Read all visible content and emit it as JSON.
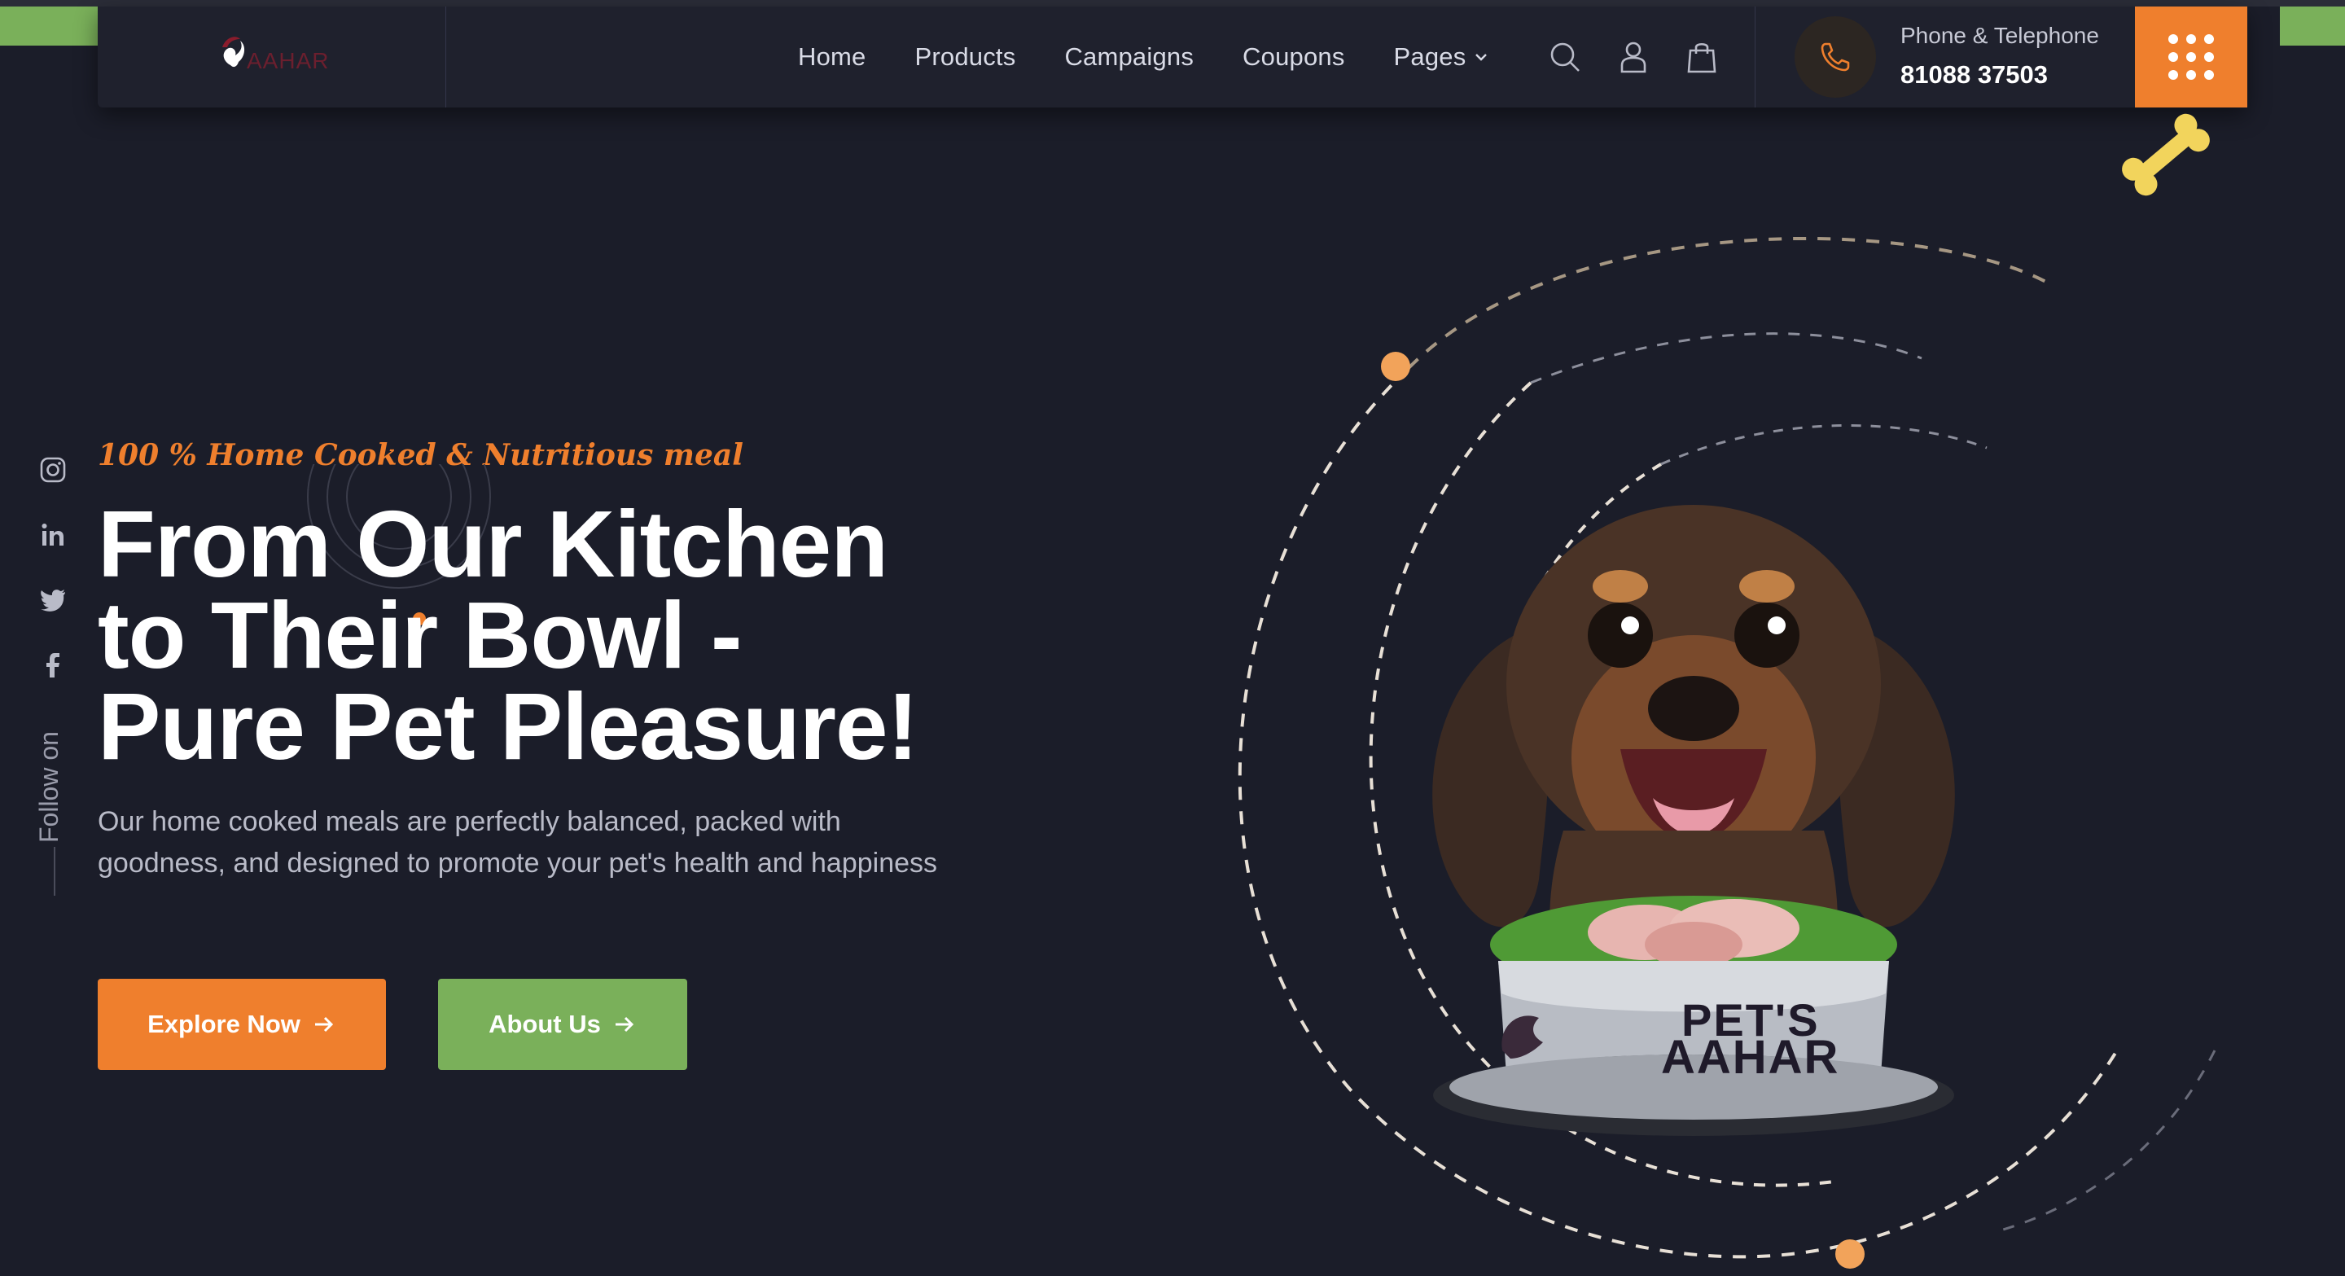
{
  "colors": {
    "background": "#1b1d29",
    "header": "#1f212d",
    "accent_orange": "#ef7f2d",
    "accent_green": "#7ab05a",
    "text_muted": "#b9bbc8"
  },
  "brand": {
    "logo_text": "AAHAR",
    "logo_icon": "dog-cat-logo-icon"
  },
  "nav": {
    "items": [
      {
        "label": "Home"
      },
      {
        "label": "Products"
      },
      {
        "label": "Campaigns"
      },
      {
        "label": "Coupons"
      },
      {
        "label": "Pages",
        "has_dropdown": true
      }
    ],
    "icons": [
      "search-icon",
      "user-icon",
      "shopping-bag-icon"
    ]
  },
  "contact": {
    "label": "Phone & Telephone",
    "number": "81088 37503",
    "icon": "phone-icon"
  },
  "menu_button": {
    "icon": "grid-menu-icon"
  },
  "social": {
    "follow_label": "Follow on",
    "icons": [
      "instagram-icon",
      "linkedin-icon",
      "twitter-icon",
      "facebook-icon"
    ]
  },
  "hero": {
    "tagline": "100 % Home Cooked & Nutritious meal",
    "headline_line1": "From Our Kitchen",
    "headline_line2": "to Their Bowl -",
    "headline_line3": "Pure Pet Pleasure!",
    "subtext": "Our home cooked meals are perfectly balanced, packed with goodness, and designed to promote your pet's health and happiness",
    "explore_label": "Explore Now",
    "about_label": "About Us",
    "bowl_line1": "PET'S",
    "bowl_line2": "AAHAR"
  }
}
